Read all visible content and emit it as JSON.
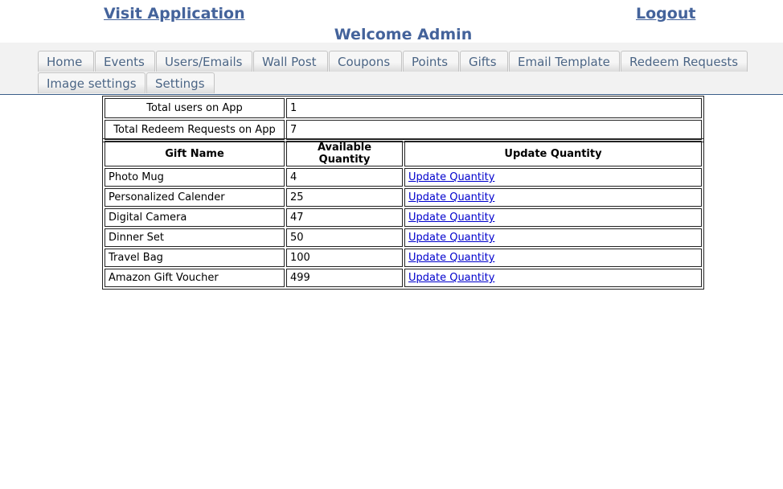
{
  "header": {
    "visit_link": "Visit Application",
    "logout_link": "Logout",
    "welcome": "Welcome Admin"
  },
  "nav": {
    "tabs": [
      {
        "label": "Home"
      },
      {
        "label": "Events"
      },
      {
        "label": "Users/Emails"
      },
      {
        "label": "Wall Post"
      },
      {
        "label": "Coupons"
      },
      {
        "label": "Points"
      },
      {
        "label": "Gifts"
      },
      {
        "label": "Email Template"
      },
      {
        "label": "Redeem Requests"
      },
      {
        "label": "Image settings"
      },
      {
        "label": "Settings"
      }
    ]
  },
  "summary": {
    "rows": [
      {
        "label": "Total users on App",
        "value": "1"
      },
      {
        "label": "Total Redeem Requests on App",
        "value": "7"
      }
    ]
  },
  "gifts": {
    "headers": [
      "Gift Name",
      "Available Quantity",
      "Update Quantity"
    ],
    "rows": [
      {
        "name": "Photo Mug",
        "qty": "4",
        "action": "Update Quantity"
      },
      {
        "name": "Personalized Calender",
        "qty": "25",
        "action": "Update Quantity"
      },
      {
        "name": "Digital Camera",
        "qty": "47",
        "action": "Update Quantity"
      },
      {
        "name": "Dinner Set",
        "qty": "50",
        "action": "Update Quantity"
      },
      {
        "name": "Travel Bag",
        "qty": "100",
        "action": "Update Quantity"
      },
      {
        "name": "Amazon Gift Voucher",
        "qty": "499",
        "action": "Update Quantity"
      }
    ]
  },
  "colors": {
    "header_text": "#44639b",
    "tab_text": "#4b6585",
    "nav_background": "#f2f2f2",
    "link": "#0000cc"
  }
}
